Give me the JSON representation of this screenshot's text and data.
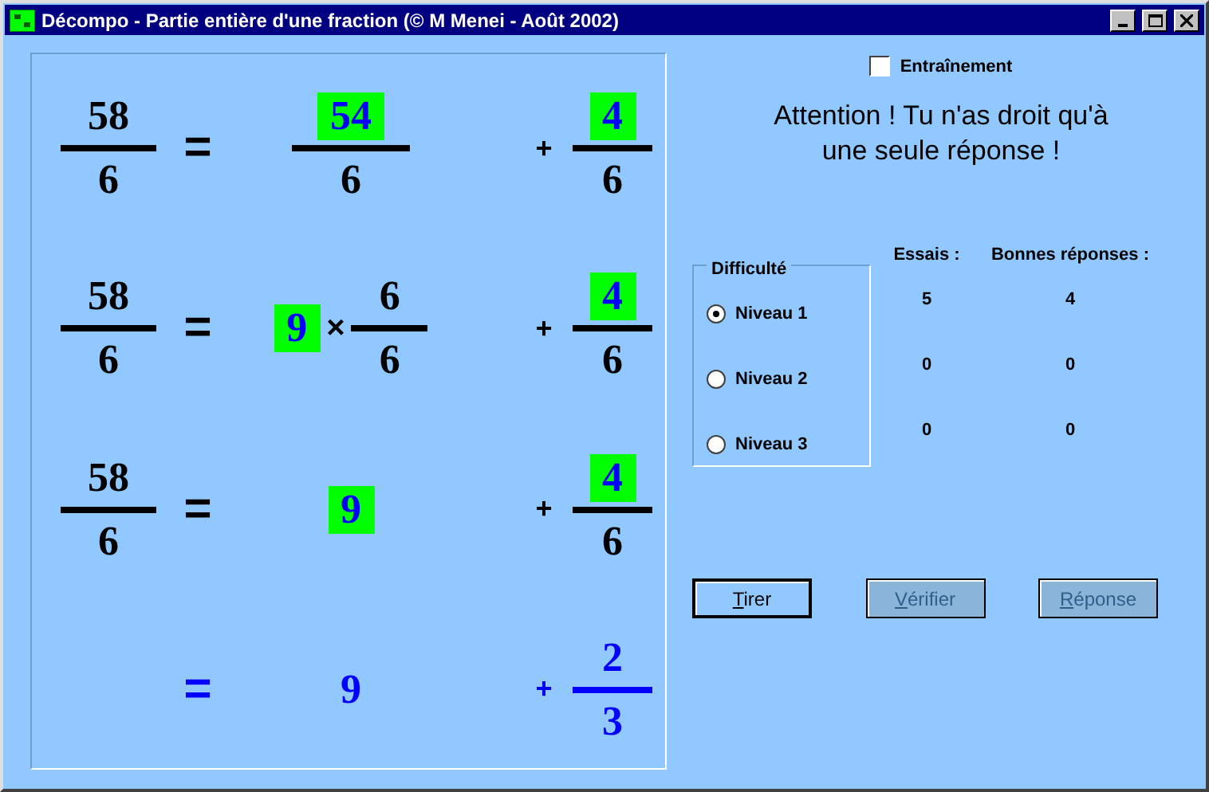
{
  "window": {
    "title": "Décompo - Partie entière d'une fraction (© M Menei - Août 2002)"
  },
  "equations": [
    {
      "final": false,
      "lhs": {
        "num": "58",
        "den": "6"
      },
      "equals": "=",
      "middle": {
        "kind": "fraction",
        "num": "54",
        "den": "6",
        "highlighted": true
      },
      "plus": "+",
      "rhs": {
        "num": "4",
        "den": "6",
        "highlighted": true
      }
    },
    {
      "final": false,
      "lhs": {
        "num": "58",
        "den": "6"
      },
      "equals": "=",
      "middle": {
        "kind": "product",
        "factor": "9",
        "times": "×",
        "num": "6",
        "den": "6",
        "highlighted": true
      },
      "plus": "+",
      "rhs": {
        "num": "4",
        "den": "6",
        "highlighted": true
      }
    },
    {
      "final": false,
      "lhs": {
        "num": "58",
        "den": "6"
      },
      "equals": "=",
      "middle": {
        "kind": "integer",
        "value": "9",
        "highlighted": true
      },
      "plus": "+",
      "rhs": {
        "num": "4",
        "den": "6",
        "highlighted": true
      }
    },
    {
      "final": true,
      "equals": "=",
      "middle": {
        "kind": "integer",
        "value": "9",
        "highlighted": false
      },
      "plus": "+",
      "rhs": {
        "num": "2",
        "den": "3",
        "highlighted": false
      }
    }
  ],
  "training": {
    "label": "Entraînement",
    "checked": false
  },
  "message": "Attention ! Tu n'as droit qu'à une seule réponse !",
  "difficulty": {
    "title": "Difficulté",
    "levels": [
      {
        "label": "Niveau 1",
        "selected": true
      },
      {
        "label": "Niveau 2",
        "selected": false
      },
      {
        "label": "Niveau 3",
        "selected": false
      }
    ]
  },
  "scores": {
    "columns": [
      "Essais :",
      "Bonnes réponses :"
    ],
    "rows": [
      [
        "5",
        "4"
      ],
      [
        "0",
        "0"
      ],
      [
        "0",
        "0"
      ]
    ]
  },
  "buttons": [
    {
      "label": "Tirer",
      "disabled": false,
      "focused": true
    },
    {
      "label": "Vérifier",
      "disabled": true,
      "focused": false
    },
    {
      "label": "Réponse",
      "disabled": true,
      "focused": false
    }
  ]
}
